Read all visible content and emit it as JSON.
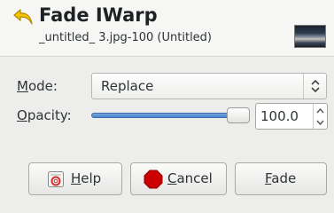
{
  "dialog": {
    "title": "Fade IWarp",
    "subtitle": "_untitled_ 3.jpg-100 (Untitled)"
  },
  "mode": {
    "label_accel": "M",
    "label_rest": "ode:",
    "value": "Replace"
  },
  "opacity": {
    "label_accel": "O",
    "label_rest": "pacity:",
    "value": "100.0",
    "level_percent": 100
  },
  "buttons": {
    "help_accel": "H",
    "help_rest": "elp",
    "cancel_accel": "C",
    "cancel_rest": "ancel",
    "fade_accel": "F",
    "fade_rest": "ade"
  },
  "colors": {
    "slider_fill": "#4a86cf",
    "cancel_icon": "#cc0000",
    "undo_arrow": "#f5c400"
  }
}
